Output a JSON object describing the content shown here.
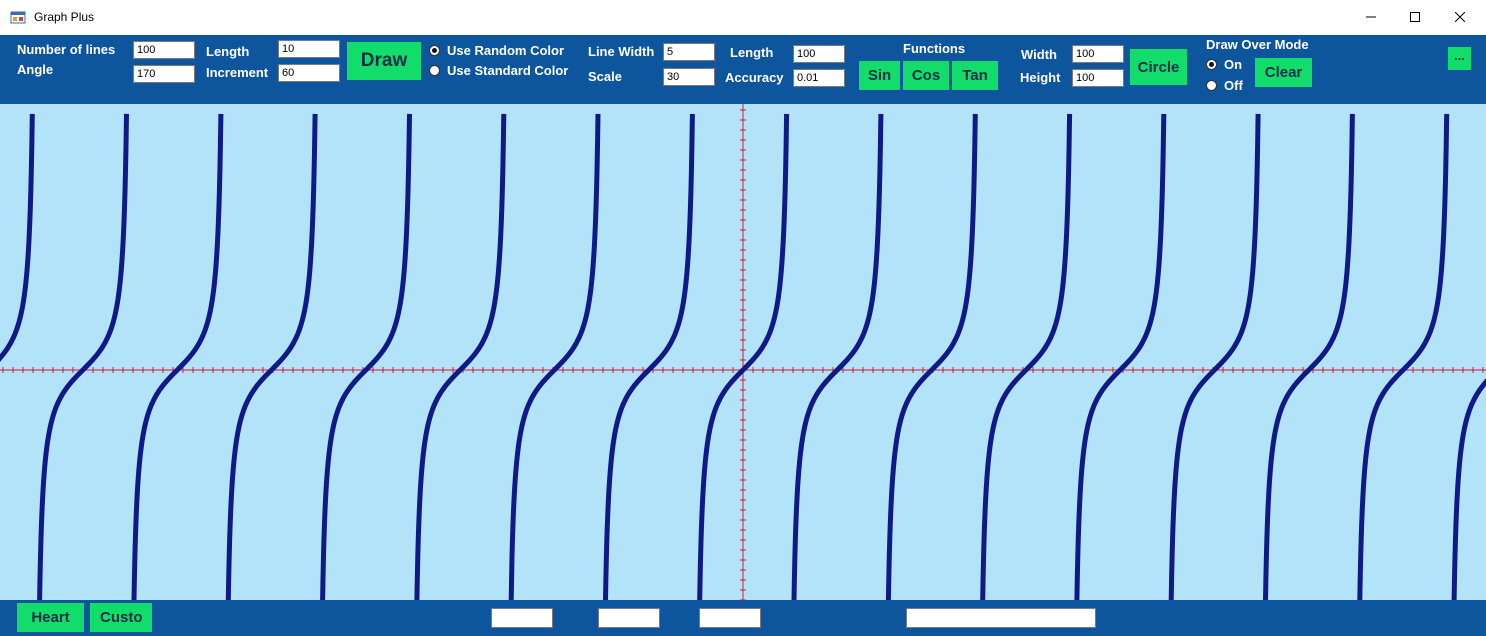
{
  "window": {
    "title": "Graph Plus",
    "icon": "app-icon"
  },
  "colors": {
    "toolbar": "#0d559c",
    "canvas": "#b3e3f8",
    "button": "#12dd6a",
    "curve": "#101a86",
    "axis": "#d6183a"
  },
  "params": {
    "num_lines_label": "Number of lines",
    "num_lines_value": "100",
    "angle_label": "Angle",
    "angle_value": "170",
    "length_label": "Length",
    "length_value": "10",
    "increment_label": "Increment",
    "increment_value": "60",
    "draw_label": "Draw",
    "random_color_label": "Use Random Color",
    "standard_color_label": "Use Standard Color",
    "color_mode_selected": "random"
  },
  "functions": {
    "line_width_label": "Line Width",
    "line_width_value": "5",
    "scale_label": "Scale",
    "scale_value": "30",
    "length_label": "Length",
    "length_value": "100",
    "accuracy_label": "Accuracy",
    "accuracy_value": "0.01",
    "heading": "Functions",
    "sin_label": "Sin",
    "cos_label": "Cos",
    "tan_label": "Tan"
  },
  "circle": {
    "width_label": "Width",
    "width_value": "100",
    "height_label": "Height",
    "height_value": "100",
    "button_label": "Circle"
  },
  "draw_over": {
    "heading": "Draw Over Mode",
    "on_label": "On",
    "off_label": "Off",
    "selected": "on",
    "clear_label": "Clear"
  },
  "more_button_label": "...",
  "bottom": {
    "heart_label": "Heart",
    "custom_label": "Custo",
    "field1_value": "",
    "field2_value": "",
    "field3_value": "",
    "field4_value": ""
  },
  "plot": {
    "function": "tan",
    "scale": 30,
    "line_width": 5
  }
}
